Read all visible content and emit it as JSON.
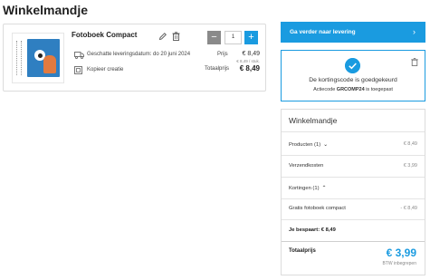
{
  "page": {
    "title": "Winkelmandje"
  },
  "product": {
    "name": "Fotoboek Compact",
    "quantity": "1",
    "delivery_text": "Geschatte leveringsdatum: do 20 juni 2024",
    "copy_label": "Kopieer creatie",
    "price_label": "Prijs",
    "price": "€ 8,49",
    "unit_price": "€ 8,49 / stuk.",
    "total_label": "Totaalprijs",
    "total": "€ 8,49",
    "qty_minus": "−",
    "qty_plus": "+"
  },
  "checkout": {
    "continue_label": "Ga verder naar levering",
    "continue_chevron": "›"
  },
  "promo": {
    "message": "De kortingscode is goedgekeurd",
    "code_prefix": "Actiecode",
    "code": "GRCOMP24",
    "code_suffix": "is toegepast"
  },
  "summary": {
    "title": "Winkelmandje",
    "products_label": "Producten (1)",
    "products_value": "€ 8,49",
    "shipping_label": "Verzendkosten",
    "shipping_value": "€ 3,99",
    "discounts_label": "Kortingen (1)",
    "discount_item_label": "Gratis fotoboek compact",
    "discount_item_value": "- € 8,49",
    "savings_text": "Je bespaart: € 8,49",
    "total_label": "Totaalprijs",
    "total_value": "€ 3,99",
    "vat_text": "BTW inbegrepen"
  },
  "colors": {
    "accent": "#1a9be0",
    "minus_button": "#8a8a8a",
    "border": "#dcdcdc"
  },
  "icons": [
    "edit-icon",
    "trash-icon",
    "truck-icon",
    "copy-icon",
    "check-icon",
    "chevron-right-icon",
    "chevron-down-icon",
    "chevron-up-icon"
  ]
}
